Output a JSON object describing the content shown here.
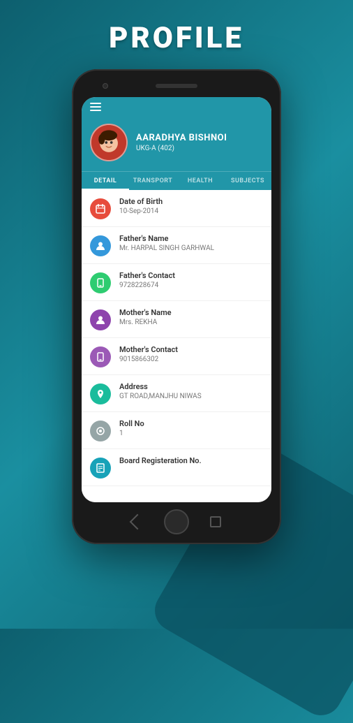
{
  "page": {
    "title": "PROFILE"
  },
  "profile": {
    "name": "AARADHYA BISHNOI",
    "class": "UKG-A (402)"
  },
  "tabs": [
    {
      "id": "detail",
      "label": "DETAIL",
      "active": true
    },
    {
      "id": "transport",
      "label": "TRANSPORT",
      "active": false
    },
    {
      "id": "health",
      "label": "HEALTH",
      "active": false
    },
    {
      "id": "subjects",
      "label": "SUBJECTS",
      "active": false
    }
  ],
  "detail_items": [
    {
      "icon": "📅",
      "icon_class": "icon-red",
      "label": "Date of Birth",
      "value": "10-Sep-2014"
    },
    {
      "icon": "👤",
      "icon_class": "icon-blue",
      "label": "Father's Name",
      "value": "Mr. HARPAL SINGH GARHWAL"
    },
    {
      "icon": "📱",
      "icon_class": "icon-green",
      "label": "Father's Contact",
      "value": "9728228674"
    },
    {
      "icon": "👤",
      "icon_class": "icon-purple-dark",
      "label": "Mother's Name",
      "value": "Mrs. REKHA"
    },
    {
      "icon": "📱",
      "icon_class": "icon-purple",
      "label": "Mother's Contact",
      "value": "9015866302"
    },
    {
      "icon": "🏠",
      "icon_class": "icon-teal",
      "label": "Address",
      "value": "GT ROAD,MANJHU NIWAS"
    },
    {
      "icon": "⚙",
      "icon_class": "icon-gray",
      "label": "Roll No",
      "value": "1"
    },
    {
      "icon": "📋",
      "icon_class": "icon-cyan",
      "label": "Board Registeration No.",
      "value": ""
    }
  ],
  "colors": {
    "header_bg": "#2196a8",
    "accent": "#17a2b8"
  }
}
